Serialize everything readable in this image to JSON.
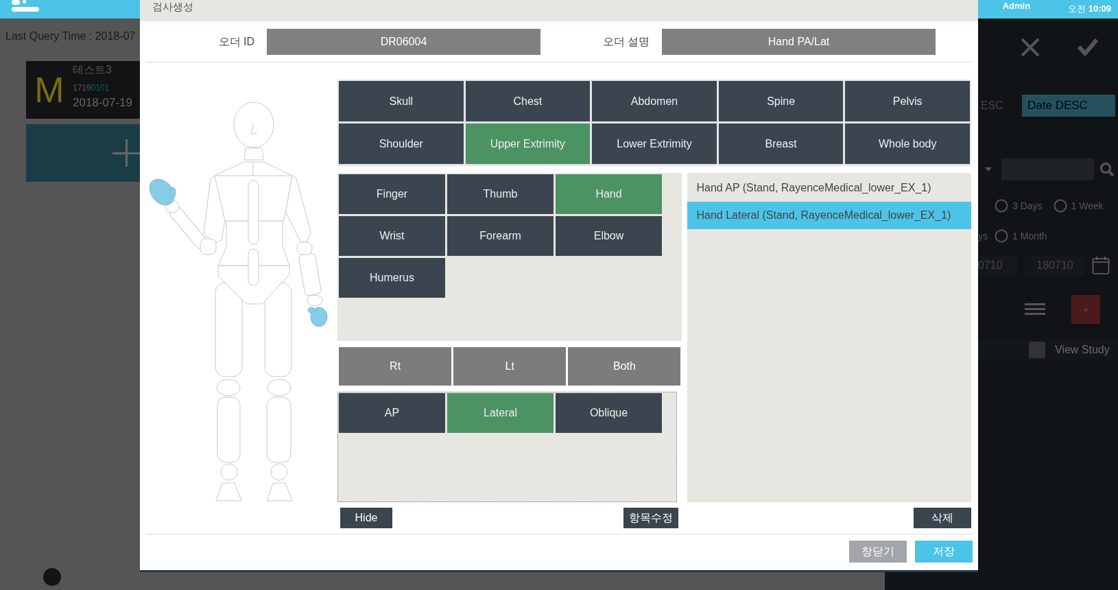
{
  "top_bar": {
    "user": "Admin",
    "time": "오전 **10:09**"
  },
  "worklist": {
    "last_query": "Last Query Time : 2018-07",
    "patients": [
      {
        "initial": "M",
        "name": "테스트3",
        "id_prefix": "1719",
        "id_suffix": "0101",
        "date": "2018-07-19"
      }
    ]
  },
  "filter_panel": {
    "sort_partial": "ESC",
    "sort": "Date DESC",
    "period_rows": [
      {
        "items": [
          {
            "label": "3 Days",
            "selected": false
          },
          {
            "label": "1 Week",
            "selected": false
          }
        ]
      },
      {
        "partial": "ys",
        "items": [
          {
            "label": "1 Month",
            "selected": false
          }
        ]
      }
    ],
    "date_from": "0710",
    "date_to": "180710",
    "add_label": "+",
    "view_study": {
      "label": "View Study",
      "checked": false
    }
  },
  "dialog": {
    "title": "검사생성",
    "order_id_label": "오더 ID",
    "order_id": "DR06004",
    "order_desc_label": "오더 설명",
    "order_desc": "Hand PA/Lat",
    "body_parts": [
      {
        "label": "Skull",
        "selected": false
      },
      {
        "label": "Chest",
        "selected": false
      },
      {
        "label": "Abdomen",
        "selected": false
      },
      {
        "label": "Spine",
        "selected": false
      },
      {
        "label": "Pelvis",
        "selected": false
      },
      {
        "label": "Shoulder",
        "selected": false
      },
      {
        "label": "Upper Extrimity",
        "selected": true
      },
      {
        "label": "Lower Extrimity",
        "selected": false
      },
      {
        "label": "Breast",
        "selected": false
      },
      {
        "label": "Whole body",
        "selected": false
      }
    ],
    "sub_parts": [
      {
        "label": "Finger",
        "selected": false
      },
      {
        "label": "Thumb",
        "selected": false
      },
      {
        "label": "Hand",
        "selected": true
      },
      {
        "label": "Wrist",
        "selected": false
      },
      {
        "label": "Forearm",
        "selected": false
      },
      {
        "label": "Elbow",
        "selected": false
      },
      {
        "label": "Humerus",
        "selected": false
      }
    ],
    "sides": [
      {
        "label": "Rt",
        "selected": false
      },
      {
        "label": "Lt",
        "selected": false
      },
      {
        "label": "Both",
        "selected": false
      }
    ],
    "projections": [
      {
        "label": "AP",
        "selected": false
      },
      {
        "label": "Lateral",
        "selected": true
      },
      {
        "label": "Oblique",
        "selected": false
      }
    ],
    "protocols": [
      {
        "label": "Hand AP (Stand, RayenceMedical_lower_EX_1)",
        "selected": false
      },
      {
        "label": "Hand Lateral (Stand, RayenceMedical_lower_EX_1)",
        "selected": true
      }
    ],
    "hide_button": "Hide",
    "edit_button": "항목수정",
    "delete_button": "삭제",
    "close_button": "창닫기",
    "save_button": "저장"
  }
}
